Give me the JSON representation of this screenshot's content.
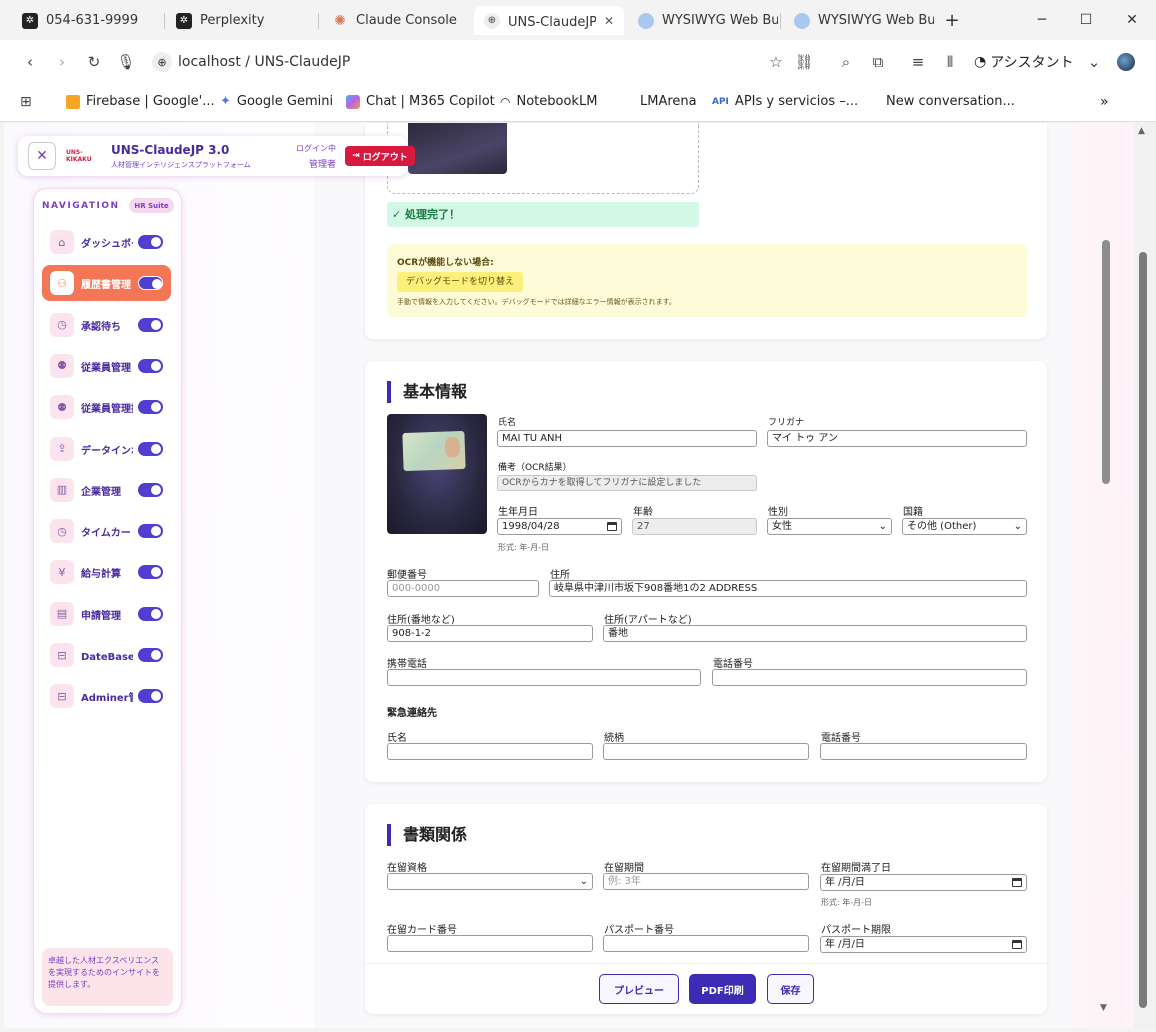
{
  "browser": {
    "tabs": [
      {
        "label": "054-631-9999",
        "active": false
      },
      {
        "label": "Perplexity",
        "active": false
      },
      {
        "label": "Claude Console",
        "active": false
      },
      {
        "label": "UNS-ClaudeJP - 人材",
        "active": true
      },
      {
        "label": "WYSIWYG Web Buil",
        "active": false
      },
      {
        "label": "WYSIWYG Web Buil",
        "active": false
      }
    ],
    "url": "localhost / UNS-ClaudeJP",
    "assistant_label": "アシスタント",
    "bookmarks": [
      "Firebase | Google'...",
      "Google Gemini",
      "Chat | M365 Copilot",
      "NotebookLM",
      "LMArena",
      "APIs y servicios –...",
      "New conversation..."
    ],
    "api_badge": "API"
  },
  "header": {
    "app_title": "UNS-ClaudeJP 3.0",
    "subtitle": "人材管理インテリジェンスプラットフォーム",
    "logo_text": "UNS-KIKAKU",
    "login_status": "ログイン中",
    "role": "管理者",
    "logout_label": "ログアウト"
  },
  "sidebar": {
    "title": "NAVIGATION",
    "badge": "HR Suite",
    "items": [
      {
        "label": "ダッシュボード",
        "icon": "home-icon",
        "active": false
      },
      {
        "label": "履歴書管理",
        "icon": "user-plus-icon",
        "active": true
      },
      {
        "label": "承認待ち",
        "icon": "clock-icon",
        "active": false
      },
      {
        "label": "従業員管理",
        "icon": "users-icon",
        "active": false
      },
      {
        "label": "従業員管理拡張",
        "icon": "users-icon",
        "active": false
      },
      {
        "label": "データインポート",
        "icon": "upload-icon",
        "active": false
      },
      {
        "label": "企業管理",
        "icon": "building-icon",
        "active": false
      },
      {
        "label": "タイムカード",
        "icon": "clock-icon",
        "active": false
      },
      {
        "label": "給与計算",
        "icon": "yen-icon",
        "active": false
      },
      {
        "label": "申請管理",
        "icon": "document-icon",
        "active": false
      },
      {
        "label": "DateBase管理",
        "icon": "database-icon",
        "active": false
      },
      {
        "label": "Adminer管理",
        "icon": "database-icon",
        "active": false
      }
    ],
    "footer_text": "卓越した人材エクスペリエンスを実現するためのインサイトを提供します。"
  },
  "ocr": {
    "done_text": "✓ 処理完了！",
    "fail_title": "OCRが機能しない場合:",
    "debug_button": "デバッグモードを切り替え",
    "note": "手動で情報を入力してください。デバッグモードでは詳細なエラー情報が表示されます。"
  },
  "basic_info": {
    "title": "基本情報",
    "name_label": "氏名",
    "name_value": "MAI TU ANH",
    "furigana_label": "フリガナ",
    "furigana_value": "マイ トゥ アン",
    "remarks_label": "備考（OCR結果）",
    "remarks_value": "OCRからカナを取得してフリガナに設定しました",
    "birthdate_label": "生年月日",
    "birthdate_value": "1998/04/28",
    "birthdate_hint": "形式: 年-月-日",
    "age_label": "年齢",
    "age_value": "27",
    "gender_label": "性別",
    "gender_value": "女性",
    "nationality_label": "国籍",
    "nationality_value": "その他 (Other)",
    "postal_label": "郵便番号",
    "postal_placeholder": "000-0000",
    "address_label": "住所",
    "address_value": "岐阜県中津川市坂下908番地1の2 ADDRESS",
    "address_num_label": "住所(番地など)",
    "address_num_value": "908-1-2",
    "address_apt_label": "住所(アパートなど)",
    "address_apt_value": "番地",
    "mobile_label": "携帯電話",
    "phone_label": "電話番号",
    "emergency_title": "緊急連絡先",
    "em_name_label": "氏名",
    "em_relation_label": "続柄",
    "em_phone_label": "電話番号"
  },
  "documents": {
    "title": "書類関係",
    "status_label": "在留資格",
    "period_label": "在留期間",
    "period_placeholder": "例: 3年",
    "expiry_label": "在留期間満了日",
    "date_placeholder": "年 /月/日",
    "date_hint": "形式: 年-月-日",
    "card_label": "在留カード番号",
    "passport_label": "パスポート番号",
    "passport_expiry_label": "パスポート期限"
  },
  "actions": {
    "preview": "プレビュー",
    "pdf": "PDF印刷",
    "save": "保存"
  }
}
